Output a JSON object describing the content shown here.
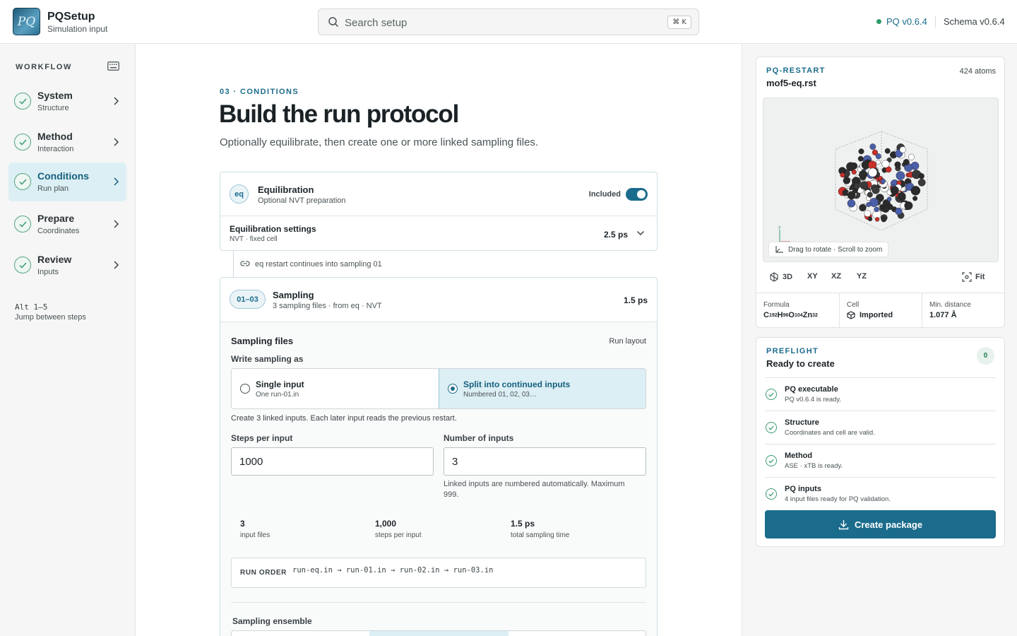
{
  "app": {
    "logo_text": "PQ",
    "title": "PQSetup",
    "subtitle": "Simulation input"
  },
  "search": {
    "placeholder": "Search setup",
    "shortcut": "⌘ K"
  },
  "header": {
    "version": "PQ v0.6.4",
    "schema": "Schema v0.6.4",
    "status_color": "#2e9a6c"
  },
  "sidebar": {
    "label": "WORKFLOW",
    "items": [
      {
        "title": "System",
        "sub": "Structure",
        "done": true
      },
      {
        "title": "Method",
        "sub": "Interaction",
        "done": true
      },
      {
        "title": "Conditions",
        "sub": "Run plan",
        "done": true,
        "active": true
      },
      {
        "title": "Prepare",
        "sub": "Coordinates",
        "done": true
      },
      {
        "title": "Review",
        "sub": "Inputs",
        "done": true
      }
    ],
    "hint_key": "Alt 1–5",
    "hint_text": "Jump between steps"
  },
  "main": {
    "eyebrow": "03 · CONDITIONS",
    "title": "Build the run protocol",
    "description": "Optionally equilibrate, then create one or more linked sampling files.",
    "equilibration": {
      "badge": "eq",
      "title": "Equilibration",
      "subtitle": "Optional NVT preparation",
      "toggle_label": "Included",
      "included": true,
      "settings_title": "Equilibration settings",
      "settings_sub": "NVT · fixed cell",
      "settings_value": "2.5 ps"
    },
    "link_text": "eq restart continues into sampling 01",
    "sampling": {
      "badge": "01–03",
      "title": "Sampling",
      "subtitle": "3 sampling files · from eq · NVT",
      "value": "1.5 ps",
      "files_title": "Sampling files",
      "run_layout": "Run layout",
      "write_as": "Write sampling as",
      "options": [
        {
          "title": "Single input",
          "sub": "One run-01.in",
          "selected": false
        },
        {
          "title": "Split into continued inputs",
          "sub": "Numbered 01, 02, 03…",
          "selected": true
        }
      ],
      "create_note": "Create 3 linked inputs. Each later input reads the previous restart.",
      "steps_label": "Steps per input",
      "steps_value": "1000",
      "inputs_label": "Number of inputs",
      "inputs_value": "3",
      "inputs_note": "Linked inputs are numbered automatically. Maximum 999.",
      "stats": [
        {
          "value": "3",
          "label": "input files"
        },
        {
          "value": "1,000",
          "label": "steps per input"
        },
        {
          "value": "1.5 ps",
          "label": "total sampling time"
        }
      ],
      "run_order_label": "RUN ORDER",
      "run_order": "run-eq.in → run-01.in → run-02.in → run-03.in",
      "ensemble_title": "Sampling ensemble"
    }
  },
  "restart": {
    "eyebrow": "PQ-RESTART",
    "file": "mof5-eq.rst",
    "atoms": "424 atoms",
    "axis_label": "y",
    "drag_hint": "Drag to rotate · Scroll to zoom",
    "views": [
      "3D",
      "XY",
      "XZ",
      "YZ"
    ],
    "fit": "Fit",
    "formula_label": "Formula",
    "formula": [
      [
        "C",
        "192"
      ],
      [
        "H",
        "96"
      ],
      [
        "O",
        "104"
      ],
      [
        "Zn",
        "32"
      ]
    ],
    "cell_label": "Cell",
    "cell_value": "Imported",
    "dist_label": "Min. distance",
    "dist_value": "1.077 Å"
  },
  "preflight": {
    "eyebrow": "PREFLIGHT",
    "title": "Ready to create",
    "count": "0",
    "items": [
      {
        "name": "PQ executable",
        "desc": "PQ v0.6.4 is ready."
      },
      {
        "name": "Structure",
        "desc": "Coordinates and cell are valid."
      },
      {
        "name": "Method",
        "desc": "ASE · xTB is ready."
      },
      {
        "name": "PQ inputs",
        "desc": "4 input files ready for PQ validation."
      }
    ],
    "button": "Create package"
  }
}
